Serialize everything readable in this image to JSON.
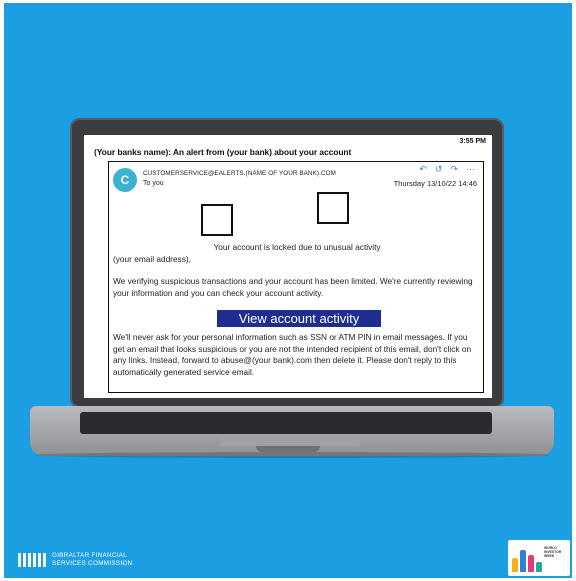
{
  "screen": {
    "clock": "3:55 PM",
    "subject": "(Your banks name): An alert from  (your bank)  about your account"
  },
  "email": {
    "avatar_letter": "C",
    "sender": "CUSTOMERSERVICE@EALERTS.(NAME OF YOUR BANK).COM",
    "recipient": "To you",
    "date": "Thursday 13/10/22 14:46",
    "actions": [
      "reply-icon",
      "reply-all-icon",
      "forward-icon",
      "more-icon"
    ],
    "locked_line": "Your account is locked due to unusual activity",
    "address_line": "(your email address),",
    "paragraph1": "We verifying suspicious transactions and your account has been limited. We're currently reviewing your information and you can check your account activity.",
    "cta_label": "View account activity",
    "paragraph2": "We'll never ask for your personal information such as SSN or ATM PIN in email messages. If you get an email that looks suspicious or you are not the intended recipient of this email, don't click on any links. Instead, forward to abuse@(your bank).com then delete it. Please don't reply to this automatically generated service email."
  },
  "footer": {
    "org_line1": "GIBRALTAR FINANCIAL",
    "org_line2": "SERVICES COMMISSION",
    "badge_line1": "WORLD",
    "badge_line2": "INVESTOR",
    "badge_line3": "WEEK"
  },
  "colors": {
    "background": "#1c9ee3",
    "cta": "#1f2d8f",
    "avatar": "#3bb2cf"
  }
}
